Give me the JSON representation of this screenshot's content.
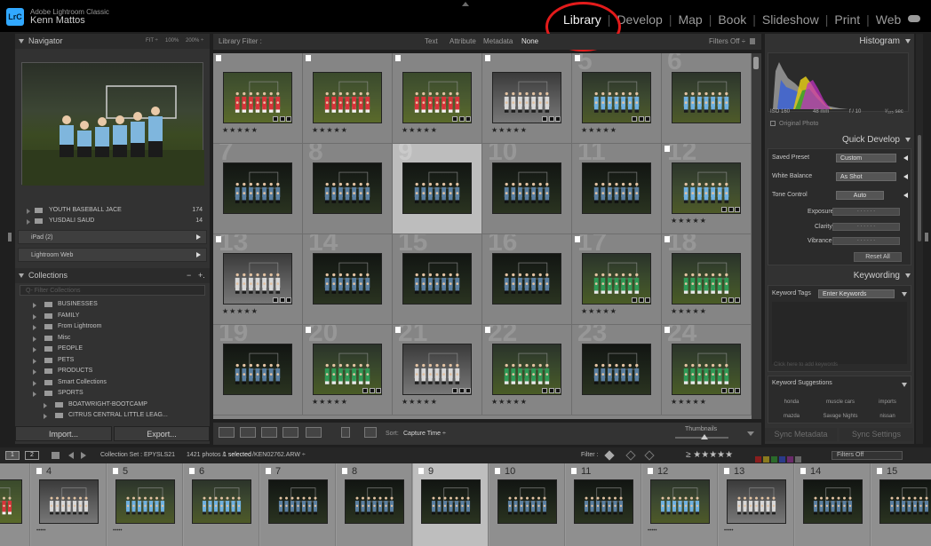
{
  "app": {
    "name": "Adobe Lightroom Classic",
    "logo": "LrC",
    "user": "Kenn Mattos"
  },
  "modules": [
    {
      "label": "Library",
      "active": true
    },
    {
      "label": "Develop",
      "active": false
    },
    {
      "label": "Map",
      "active": false
    },
    {
      "label": "Book",
      "active": false
    },
    {
      "label": "Slideshow",
      "active": false
    },
    {
      "label": "Print",
      "active": false
    },
    {
      "label": "Web",
      "active": false
    }
  ],
  "navigator": {
    "title": "Navigator",
    "zoom": [
      "FIT ÷",
      "100%",
      "200% ÷"
    ]
  },
  "folders": [
    {
      "label": "YOUTH BASEBALL JACE",
      "count": "174"
    },
    {
      "label": "YUSDALI SAUD",
      "count": "14"
    }
  ],
  "publish": [
    {
      "label": "iPad (2)"
    },
    {
      "label": "Lightroom Web"
    }
  ],
  "collections": {
    "title": "Collections",
    "actions": [
      "−",
      "+."
    ],
    "filter_placeholder": "Q- Filter Collections",
    "items": [
      {
        "label": "BUSINESSES",
        "indent": 0
      },
      {
        "label": "FAMILY",
        "indent": 0
      },
      {
        "label": "From Lightroom",
        "indent": 0
      },
      {
        "label": "Misc",
        "indent": 0
      },
      {
        "label": "PEOPLE",
        "indent": 0
      },
      {
        "label": "PETS",
        "indent": 0
      },
      {
        "label": "PRODUCTS",
        "indent": 0
      },
      {
        "label": "Smart Collections",
        "indent": 0
      },
      {
        "label": "SPORTS",
        "indent": 0
      },
      {
        "label": "BOATWRIGHT-BOOTCAMP",
        "indent": 1
      },
      {
        "label": "CITRUS CENTRAL LITTLE LEAG...",
        "indent": 1
      }
    ]
  },
  "left_buttons": {
    "import": "Import...",
    "export": "Export..."
  },
  "library_filter": {
    "label": "Library Filter :",
    "options": [
      "Text",
      "Attribute",
      "Metadata",
      "None"
    ],
    "active": "None",
    "preset": "Filters Off ÷"
  },
  "grid": {
    "cells": [
      {
        "num": "",
        "flag": true,
        "stars": "★★★★★",
        "tone": "red",
        "badges": true
      },
      {
        "num": "",
        "flag": true,
        "stars": "★★★★★",
        "tone": "red",
        "badges": false
      },
      {
        "num": "",
        "flag": true,
        "stars": "★★★★★",
        "tone": "red",
        "badges": true
      },
      {
        "num": "",
        "flag": true,
        "stars": "★★★★★",
        "tone": "bw",
        "badges": true
      },
      {
        "num": "5",
        "flag": true,
        "stars": "★★★★★",
        "tone": "blue",
        "badges": true
      },
      {
        "num": "6",
        "flag": false,
        "stars": "",
        "tone": "blue",
        "badges": false
      },
      {
        "num": "7",
        "flag": false,
        "stars": "",
        "tone": "dark",
        "badges": false
      },
      {
        "num": "8",
        "flag": false,
        "stars": "",
        "tone": "dark",
        "badges": false
      },
      {
        "num": "9",
        "flag": false,
        "stars": "",
        "tone": "dark",
        "badges": false,
        "selected": true
      },
      {
        "num": "10",
        "flag": false,
        "stars": "",
        "tone": "dark",
        "badges": false
      },
      {
        "num": "11",
        "flag": false,
        "stars": "",
        "tone": "dark",
        "badges": false
      },
      {
        "num": "12",
        "flag": true,
        "stars": "★★★★★",
        "tone": "blue",
        "badges": true
      },
      {
        "num": "13",
        "flag": true,
        "stars": "★★★★★",
        "tone": "bw",
        "badges": true
      },
      {
        "num": "14",
        "flag": false,
        "stars": "",
        "tone": "dark",
        "badges": false
      },
      {
        "num": "15",
        "flag": false,
        "stars": "",
        "tone": "dark",
        "badges": false
      },
      {
        "num": "16",
        "flag": false,
        "stars": "",
        "tone": "dark",
        "badges": false
      },
      {
        "num": "17",
        "flag": true,
        "stars": "★★★★★",
        "tone": "green",
        "badges": true
      },
      {
        "num": "18",
        "flag": true,
        "stars": "★★★★★",
        "tone": "green",
        "badges": true
      },
      {
        "num": "19",
        "flag": false,
        "stars": "",
        "tone": "dark",
        "badges": false
      },
      {
        "num": "20",
        "flag": true,
        "stars": "★★★★★",
        "tone": "green",
        "badges": true
      },
      {
        "num": "21",
        "flag": true,
        "stars": "★★★★★",
        "tone": "bw",
        "badges": true
      },
      {
        "num": "22",
        "flag": true,
        "stars": "★★★★★",
        "tone": "green",
        "badges": true
      },
      {
        "num": "23",
        "flag": false,
        "stars": "",
        "tone": "dark",
        "badges": false
      },
      {
        "num": "24",
        "flag": true,
        "stars": "★★★★★",
        "tone": "green",
        "badges": true
      }
    ]
  },
  "toolbar": {
    "sort_label": "Sort:",
    "sort_value": "Capture Time ÷",
    "thumbnails_label": "Thumbnails"
  },
  "histogram": {
    "title": "Histogram",
    "info": [
      "ISO 160",
      "48 mm",
      "f / 10",
      "¹⁄₁₂₅ sec"
    ],
    "original_photo": "Original Photo"
  },
  "quick_develop": {
    "title": "Quick Develop",
    "saved_preset": {
      "label": "Saved Preset",
      "value": "Custom"
    },
    "white_balance": {
      "label": "White Balance",
      "value": "As Shot"
    },
    "tone_control": {
      "label": "Tone Control",
      "value": "Auto"
    },
    "sliders": [
      "Exposure",
      "Clarity",
      "Vibrance"
    ],
    "reset": "Reset All"
  },
  "keywording": {
    "title": "Keywording",
    "tags_label": "Keyword Tags",
    "tags_value": "Enter Keywords",
    "add_placeholder": "Click here to add keywords",
    "suggestions_label": "Keyword Suggestions",
    "suggestions": [
      "honda",
      "muscle cars",
      "imports",
      "mazda",
      "Savage Nights",
      "nissan"
    ]
  },
  "right_buttons": {
    "sync_metadata": "Sync Metadata",
    "sync_settings": "Sync Settings"
  },
  "filmstrip_bar": {
    "pages": [
      "1",
      "2"
    ],
    "source": "Collection Set : EPYSLS21",
    "count_prefix": "1421 photos /",
    "selected": "1 selected",
    "filename": "/KEN02762.ARW ÷",
    "filter_label": "Filter :",
    "rating_filter": "≥ ★★★★★",
    "filters_off": "Filters Off"
  },
  "filmstrip": [
    {
      "num": "",
      "tone": "red",
      "stars": ""
    },
    {
      "num": "4",
      "tone": "bw",
      "stars": "•••••"
    },
    {
      "num": "5",
      "tone": "blue",
      "stars": "•••••"
    },
    {
      "num": "6",
      "tone": "blue",
      "stars": ""
    },
    {
      "num": "7",
      "tone": "dark",
      "stars": ""
    },
    {
      "num": "8",
      "tone": "dark",
      "stars": ""
    },
    {
      "num": "9",
      "tone": "dark",
      "stars": "",
      "selected": true
    },
    {
      "num": "10",
      "tone": "dark",
      "stars": ""
    },
    {
      "num": "11",
      "tone": "dark",
      "stars": ""
    },
    {
      "num": "12",
      "tone": "blue",
      "stars": "•••••"
    },
    {
      "num": "13",
      "tone": "bw",
      "stars": "•••••"
    },
    {
      "num": "14",
      "tone": "dark",
      "stars": ""
    },
    {
      "num": "15",
      "tone": "dark",
      "stars": ""
    }
  ],
  "colors": {
    "accent_ring": "#e31b1b",
    "lrc_blue": "#31a8ff",
    "panel": "#323232"
  }
}
